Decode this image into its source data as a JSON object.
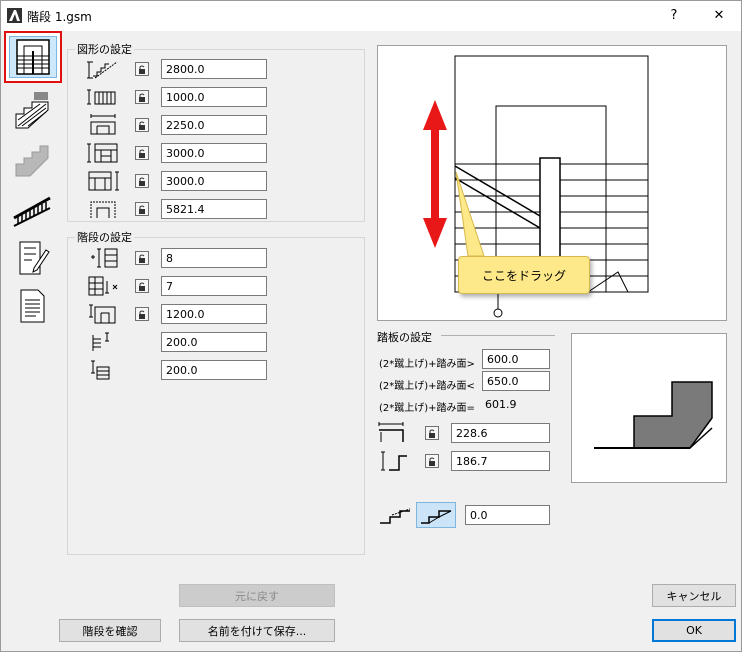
{
  "window": {
    "title": "階段 1.gsm",
    "help_glyph": "?",
    "close_glyph": "✕"
  },
  "tabs": [
    {
      "icon": "stair-plan-icon",
      "active": true
    },
    {
      "icon": "stair-section-icon",
      "active": false
    },
    {
      "icon": "stair-3d-icon",
      "active": false
    },
    {
      "icon": "railing-icon",
      "active": false
    },
    {
      "icon": "edit-pen-icon",
      "active": false
    },
    {
      "icon": "document-list-icon",
      "active": false
    }
  ],
  "shape_settings": {
    "title": "図形の設定",
    "rows": [
      {
        "icon": "slope-length-icon",
        "value": "2800.0"
      },
      {
        "icon": "width-run-icon",
        "value": "1000.0"
      },
      {
        "icon": "plan-width-icon",
        "value": "2250.0"
      },
      {
        "icon": "height-total-icon",
        "value": "3000.0"
      },
      {
        "icon": "floor-height-icon",
        "value": "3000.0"
      },
      {
        "icon": "stair-length-icon",
        "value": "5821.4"
      }
    ]
  },
  "step_settings": {
    "title": "階段の設定",
    "rows": [
      {
        "icon": "riser-count-icon",
        "value": "8",
        "lock": true
      },
      {
        "icon": "tread-count-icon",
        "value": "7",
        "lock": true
      },
      {
        "icon": "landing-length-icon",
        "value": "1200.0",
        "lock": true
      },
      {
        "icon": "riser-height-icon",
        "value": "200.0",
        "lock": false
      },
      {
        "icon": "tread-depth-icon",
        "value": "200.0",
        "lock": false
      }
    ]
  },
  "preview": {
    "callout": "ここをドラッグ",
    "arrow_color": "#e81818",
    "callout_color": "#fde98a"
  },
  "tread_settings": {
    "title": "踏板の設定",
    "formula_rows": [
      {
        "label": "(2*蹴上げ)+踏み面>",
        "value": "600.0",
        "editable": true
      },
      {
        "label": "(2*蹴上げ)+踏み面<",
        "value": "650.0",
        "editable": true
      },
      {
        "label": "(2*蹴上げ)+踏み面=",
        "value": "601.9",
        "editable": false
      }
    ],
    "dim_rows": [
      {
        "icon": "tread-width-icon",
        "value": "228.6"
      },
      {
        "icon": "riser-height-dim-icon",
        "value": "186.7"
      }
    ],
    "nosing_value": "0.0"
  },
  "buttons": {
    "reset": "元に戻す",
    "check": "階段を確認",
    "save_as": "名前を付けて保存...",
    "cancel": "キャンセル",
    "ok": "OK"
  }
}
